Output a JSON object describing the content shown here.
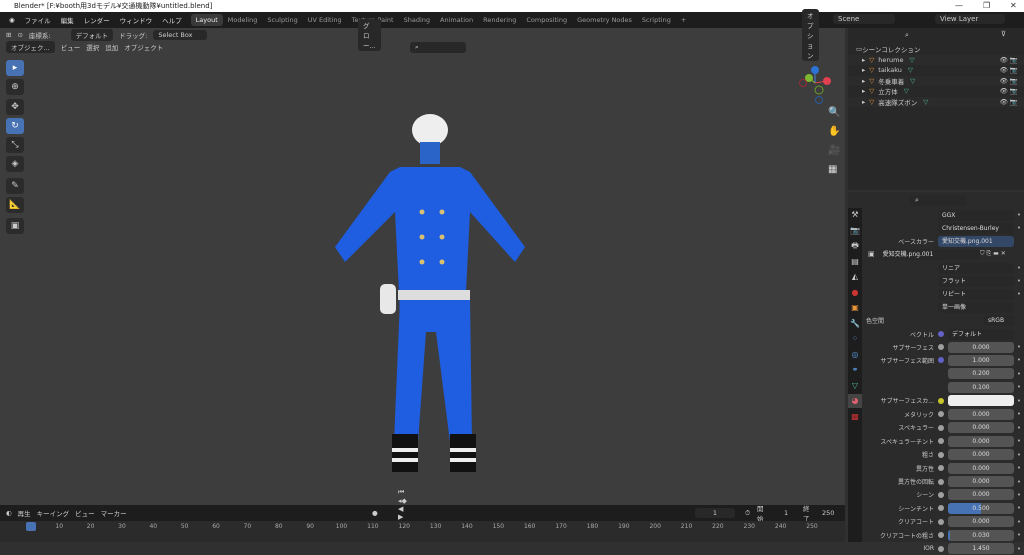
{
  "title": "Blender* [F:¥booth用3dモデル¥交通機動隊¥untitled.blend]",
  "menu": [
    "ファイル",
    "編集",
    "レンダー",
    "ウィンドウ",
    "ヘルプ"
  ],
  "workspaces": [
    "Layout",
    "Modeling",
    "Sculpting",
    "UV Editing",
    "Texture Paint",
    "Shading",
    "Animation",
    "Rendering",
    "Compositing",
    "Geometry Nodes",
    "Scripting"
  ],
  "scene": "Scene",
  "view_layer": "View Layer",
  "viewport": {
    "coord_label": "座標系:",
    "orientation": "デフォルト",
    "drag_label": "ドラッグ:",
    "drag_value": "Select Box",
    "mode": "オブジェク...",
    "menu": [
      "ビュー",
      "選択",
      "追加",
      "オブジェクト"
    ],
    "transform": "グロー...",
    "options": "オプション"
  },
  "outliner": {
    "root": "シーンコレクション",
    "items": [
      "herume",
      "taikaku",
      "冬乗車着",
      "立方体",
      "高速隊ズボン"
    ]
  },
  "properties": {
    "distribution": "GGX",
    "subsurface_method": "Christensen-Burley",
    "base_color_label": "ベースカラー",
    "base_color_value": "愛知交機.png.001",
    "image_name": "愛知交機.png.001",
    "interpolation": "リニア",
    "projection": "フラット",
    "extension": "リピート",
    "source": "単一画像",
    "color_space_label": "色空間",
    "color_space": "sRGB",
    "vector_label": "ベクトル",
    "vector_value": "デフォルト",
    "rows": [
      {
        "label": "サブサーフェス",
        "value": "0.000"
      },
      {
        "label": "サブサーフェス範囲",
        "value": "1.000"
      },
      {
        "label": "",
        "value": "0.200"
      },
      {
        "label": "",
        "value": "0.100"
      },
      {
        "label": "サブサーフェスカ...",
        "value": ""
      },
      {
        "label": "メタリック",
        "value": "0.000"
      },
      {
        "label": "スペキュラー",
        "value": "0.000"
      },
      {
        "label": "スペキュラーチント",
        "value": "0.000"
      },
      {
        "label": "粗さ",
        "value": "0.000"
      },
      {
        "label": "異方性",
        "value": "0.000"
      },
      {
        "label": "異方性の回転",
        "value": "0.000"
      },
      {
        "label": "シーン",
        "value": "0.000"
      },
      {
        "label": "シーンチント",
        "value": "0.500",
        "fill": 0.5
      },
      {
        "label": "クリアコート",
        "value": "0.000"
      },
      {
        "label": "クリアコートの粗さ",
        "value": "0.030",
        "fill": 0.03
      },
      {
        "label": "IOR",
        "value": "1.450"
      }
    ]
  },
  "timeline": {
    "menu": [
      "再生",
      "キーイング",
      "ビュー",
      "マーカー"
    ],
    "current_frame": "1",
    "start_label": "開始",
    "start": "1",
    "end_label": "終了",
    "end": "250",
    "ticks": [
      "1",
      "10",
      "20",
      "30",
      "40",
      "50",
      "60",
      "70",
      "80",
      "90",
      "100",
      "110",
      "120",
      "130",
      "140",
      "150",
      "160",
      "170",
      "180",
      "190",
      "200",
      "210",
      "220",
      "230",
      "240",
      "250"
    ]
  }
}
